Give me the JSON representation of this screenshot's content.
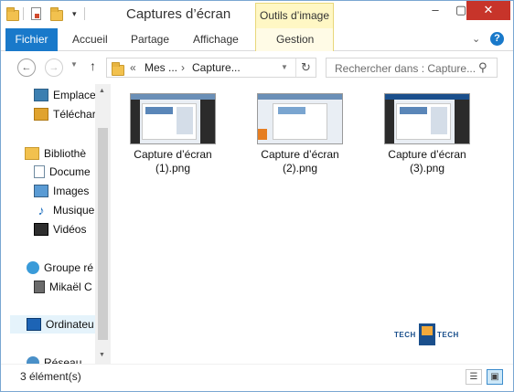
{
  "window": {
    "title": "Captures d’écran",
    "context_tab": "Outils d’image",
    "controls": {
      "minimize": "–",
      "maximize": "▢",
      "close": "✕"
    }
  },
  "ribbon": {
    "tabs": [
      {
        "label": "Fichier"
      },
      {
        "label": "Accueil"
      },
      {
        "label": "Partage"
      },
      {
        "label": "Affichage"
      },
      {
        "label": "Gestion"
      }
    ],
    "help": "?"
  },
  "address": {
    "overflow": "«",
    "crumbs": [
      "Mes ...",
      "Capture..."
    ],
    "sep": "›",
    "search_placeholder": "Rechercher dans : Capture..."
  },
  "navpane": {
    "items": [
      {
        "label": "Emplace",
        "icon": "desktop-icon"
      },
      {
        "label": "Téléchar",
        "icon": "downloads-icon"
      },
      {
        "label": "Bibliothè",
        "icon": "library-icon"
      },
      {
        "label": "Docume",
        "icon": "documents-icon"
      },
      {
        "label": "Images",
        "icon": "pictures-icon"
      },
      {
        "label": "Musique",
        "icon": "music-icon"
      },
      {
        "label": "Vidéos",
        "icon": "videos-icon"
      },
      {
        "label": "Groupe ré",
        "icon": "homegroup-icon"
      },
      {
        "label": "Mikaël C",
        "icon": "user-icon"
      },
      {
        "label": "Ordinateu",
        "icon": "computer-icon"
      },
      {
        "label": "Réseau",
        "icon": "network-icon"
      }
    ]
  },
  "files": [
    {
      "name_line1": "Capture d’écran",
      "name_line2": "(1).png"
    },
    {
      "name_line1": "Capture d’écran",
      "name_line2": "(2).png"
    },
    {
      "name_line1": "Capture d’écran",
      "name_line2": "(3).png"
    }
  ],
  "watermark": {
    "left": "TECH",
    "right": "TECH"
  },
  "status": {
    "text": "3 élément(s)"
  }
}
